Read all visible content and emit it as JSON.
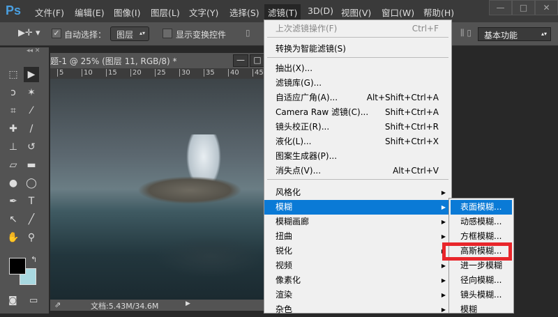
{
  "app": {
    "logo": "Ps"
  },
  "menubar": [
    "文件(F)",
    "编辑(E)",
    "图像(I)",
    "图层(L)",
    "文字(Y)",
    "选择(S)",
    "滤镜(T)",
    "3D(D)",
    "视图(V)",
    "窗口(W)",
    "帮助(H)"
  ],
  "window_controls": [
    "—",
    "□",
    "✕"
  ],
  "options": {
    "auto_select_label": "自动选择：",
    "auto_select_value": "图层",
    "show_transform_label": "显示变换控件",
    "workspace": "基本功能"
  },
  "document": {
    "tab_title": "题-1 @ 25% (图层 11, RGB/8) *",
    "ruler_ticks": [
      "5",
      "10",
      "15",
      "20",
      "25",
      "30",
      "35",
      "40",
      "45"
    ],
    "status": "文档:5.43M/34.6M"
  },
  "filter_menu": {
    "items": [
      {
        "label": "上次滤镜操作(F)",
        "shortcut": "Ctrl+F",
        "disabled": true
      },
      {
        "label": "转换为智能滤镜(S)"
      },
      {
        "label": "抽出(X)..."
      },
      {
        "label": "滤镜库(G)..."
      },
      {
        "label": "自适应广角(A)...",
        "shortcut": "Alt+Shift+Ctrl+A"
      },
      {
        "label": "Camera Raw 滤镜(C)...",
        "shortcut": "Shift+Ctrl+A"
      },
      {
        "label": "镜头校正(R)...",
        "shortcut": "Shift+Ctrl+R"
      },
      {
        "label": "液化(L)...",
        "shortcut": "Shift+Ctrl+X"
      },
      {
        "label": "图案生成器(P)..."
      },
      {
        "label": "消失点(V)...",
        "shortcut": "Alt+Ctrl+V"
      },
      {
        "label": "风格化",
        "submenu": true
      },
      {
        "label": "模糊",
        "submenu": true,
        "highlighted": true
      },
      {
        "label": "模糊画廊",
        "submenu": true
      },
      {
        "label": "扭曲",
        "submenu": true
      },
      {
        "label": "锐化",
        "submenu": true
      },
      {
        "label": "视频",
        "submenu": true
      },
      {
        "label": "像素化",
        "submenu": true
      },
      {
        "label": "渲染",
        "submenu": true
      },
      {
        "label": "杂色",
        "submenu": true
      }
    ]
  },
  "blur_submenu": {
    "items": [
      "表面模糊...",
      "动感模糊...",
      "方框模糊...",
      "高斯模糊...",
      "进一步模糊",
      "径向模糊...",
      "镜头模糊...",
      "模糊"
    ],
    "highlighted_index": 0,
    "annotated_index": 3,
    "annotation_color": "#e8262b"
  },
  "colors": {
    "accent": "#0a7ad6",
    "foreground": "#000000",
    "background": "#a8d8e0"
  }
}
